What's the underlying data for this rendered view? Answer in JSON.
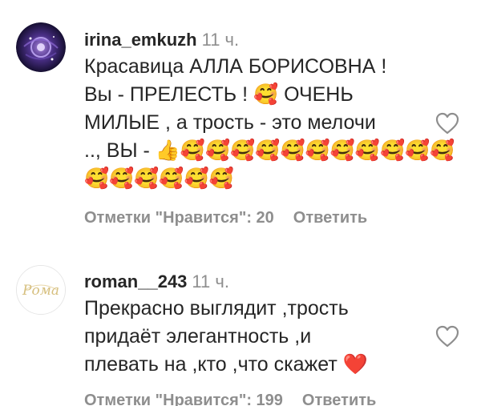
{
  "comments": [
    {
      "username": "irina_emkuzh",
      "time": "11 ч.",
      "lines": [
        "Красавица АЛЛА БОРИСОВНА !",
        "Вы - ПРЕЛЕСТЬ ! 🥰 ОЧЕНЬ",
        "МИЛЫЕ , а трость - это мелочи",
        ".., ВЫ - 👍🥰🥰🥰🥰🥰🥰🥰🥰🥰🥰🥰",
        "🥰🥰🥰🥰🥰🥰"
      ],
      "likes_label": "Отметки \"Нравится\": 20",
      "reply_label": "Ответить",
      "avatar_icon": "avatar-cosmic-circle-icon"
    },
    {
      "username": "roman__243",
      "time": "11 ч.",
      "lines": [
        "Прекрасно выглядит ,трость",
        "придаёт элегантность ,и",
        "плевать на ,кто ,что скажет ❤️"
      ],
      "likes_label": "Отметки \"Нравится\": 199",
      "reply_label": "Ответить",
      "avatar_text": "Рома",
      "avatar_icon": "avatar-roma-logo-icon"
    }
  ],
  "colors": {
    "text": "#262626",
    "secondary": "#8e8e8e",
    "heart_red": "#ed4956"
  }
}
